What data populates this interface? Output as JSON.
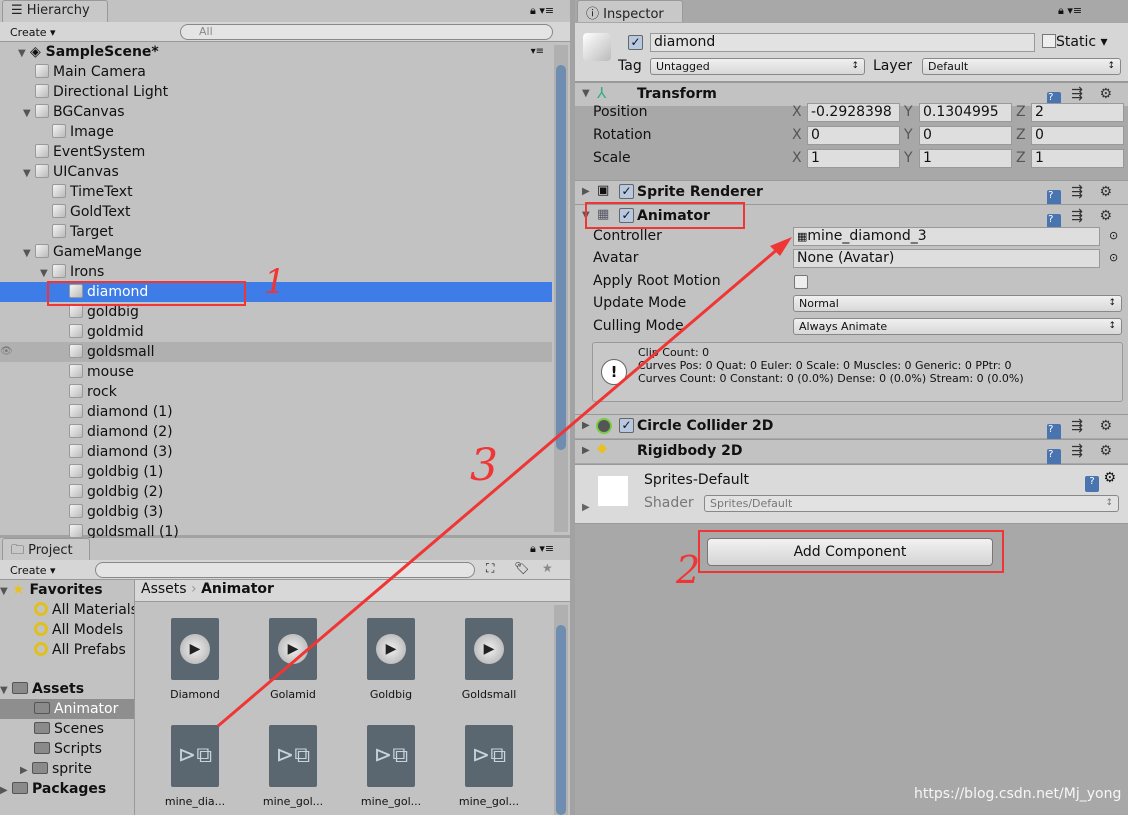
{
  "hierarchy": {
    "tab": "Hierarchy",
    "create": "Create",
    "search_placeholder": "All",
    "scene": "SampleScene*",
    "items": [
      {
        "label": "Main Camera"
      },
      {
        "label": "Directional Light"
      },
      {
        "label": "BGCanvas"
      },
      {
        "label": "Image"
      },
      {
        "label": "EventSystem"
      },
      {
        "label": "UICanvas"
      },
      {
        "label": "TimeText"
      },
      {
        "label": "GoldText"
      },
      {
        "label": "Target"
      },
      {
        "label": "GameMange"
      },
      {
        "label": "Irons"
      },
      {
        "label": "diamond"
      },
      {
        "label": "goldbig"
      },
      {
        "label": "goldmid"
      },
      {
        "label": "goldsmall"
      },
      {
        "label": "mouse"
      },
      {
        "label": "rock"
      },
      {
        "label": "diamond (1)"
      },
      {
        "label": "diamond (2)"
      },
      {
        "label": "diamond (3)"
      },
      {
        "label": "goldbig (1)"
      },
      {
        "label": "goldbig (2)"
      },
      {
        "label": "goldbig (3)"
      },
      {
        "label": "goldsmall (1)"
      }
    ]
  },
  "inspector": {
    "tab": "Inspector",
    "name": "diamond",
    "static_label": "Static",
    "tag_label": "Tag",
    "tag": "Untagged",
    "layer_label": "Layer",
    "layer": "Default",
    "transform": {
      "title": "Transform",
      "rows": [
        {
          "label": "Position",
          "x": "-0.2928398",
          "y": "0.1304995",
          "z": "2"
        },
        {
          "label": "Rotation",
          "x": "0",
          "y": "0",
          "z": "0"
        },
        {
          "label": "Scale",
          "x": "1",
          "y": "1",
          "z": "1"
        }
      ],
      "axes": [
        "X",
        "Y",
        "Z"
      ]
    },
    "sprite_renderer": "Sprite Renderer",
    "animator": {
      "title": "Animator",
      "controller_label": "Controller",
      "controller": "mine_diamond_3",
      "avatar_label": "Avatar",
      "avatar": "None (Avatar)",
      "apply_root_motion_label": "Apply Root Motion",
      "apply_root_motion": false,
      "update_mode_label": "Update Mode",
      "update_mode": "Normal",
      "culling_mode_label": "Culling Mode",
      "culling_mode": "Always Animate",
      "info": [
        "Clip Count: 0",
        "Curves Pos: 0 Quat: 0 Euler: 0 Scale: 0 Muscles: 0 Generic: 0 PPtr: 0",
        "Curves Count: 0 Constant: 0 (0.0%) Dense: 0 (0.0%) Stream: 0 (0.0%)"
      ]
    },
    "circle_collider": "Circle Collider 2D",
    "rigidbody": "Rigidbody 2D",
    "material": {
      "name": "Sprites-Default",
      "shader_label": "Shader",
      "shader": "Sprites/Default"
    },
    "add_component": "Add Component"
  },
  "project": {
    "tab": "Project",
    "create": "Create",
    "favorites": {
      "label": "Favorites",
      "items": [
        "All Materials",
        "All Models",
        "All Prefabs"
      ]
    },
    "assets": {
      "label": "Assets",
      "items": [
        "Animator",
        "Scenes",
        "Scripts",
        "sprite"
      ]
    },
    "packages": "Packages",
    "breadcrumb": [
      "Assets",
      "Animator"
    ],
    "files": [
      {
        "name": "Diamond",
        "type": "clip"
      },
      {
        "name": "Golamid",
        "type": "clip"
      },
      {
        "name": "Goldbig",
        "type": "clip"
      },
      {
        "name": "Goldsmall",
        "type": "clip"
      },
      {
        "name": "mine_dia...",
        "type": "controller"
      },
      {
        "name": "mine_gol...",
        "type": "controller"
      },
      {
        "name": "mine_gol...",
        "type": "controller"
      },
      {
        "name": "mine_gol...",
        "type": "controller"
      }
    ]
  },
  "annotations": {
    "n1": "1",
    "n2": "2",
    "n3": "3",
    "color": "#f03535"
  },
  "watermark": "https://blog.csdn.net/Mj_yong"
}
